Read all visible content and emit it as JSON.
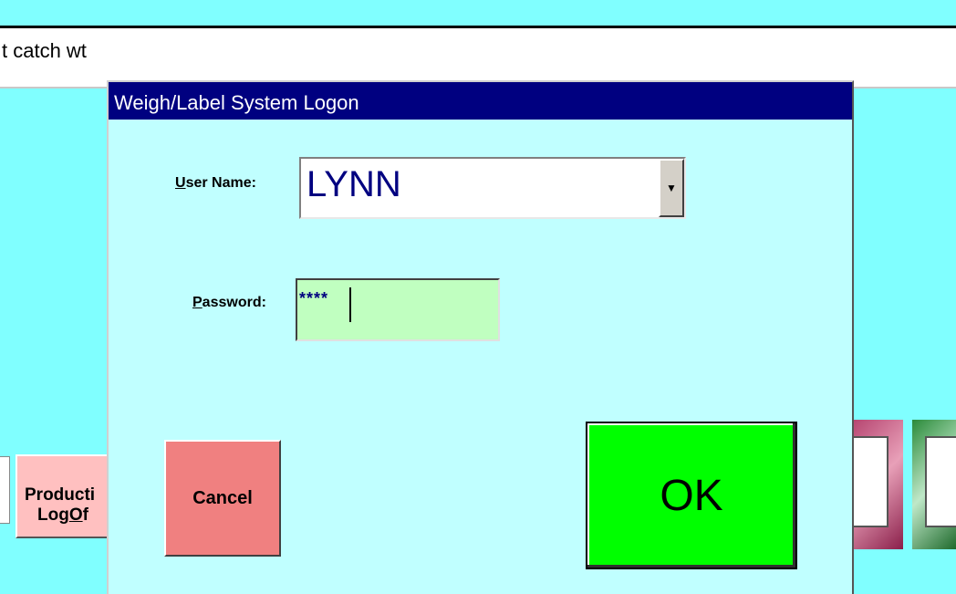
{
  "background": {
    "header_text": "t catch wt",
    "production_button": {
      "line1": "Producti",
      "line2_prefix": "Log",
      "line2_accel": "O",
      "line2_suffix": "f"
    }
  },
  "dialog": {
    "title": "Weigh/Label System Logon",
    "user_name": {
      "label_accel": "U",
      "label_rest": "ser Name:",
      "value": "LYNN",
      "dropdown_icon": "triangle-down-icon"
    },
    "password": {
      "label_accel": "P",
      "label_rest": "assword:",
      "value": "****"
    },
    "cancel_label": "Cancel",
    "ok_label": "OK"
  },
  "colors": {
    "desktop": "#80ffff",
    "dialog_bg": "#c0ffff",
    "titlebar": "#000080",
    "password_bg": "#c0ffc0",
    "cancel_bg": "#f08080",
    "ok_bg": "#00ff00"
  }
}
